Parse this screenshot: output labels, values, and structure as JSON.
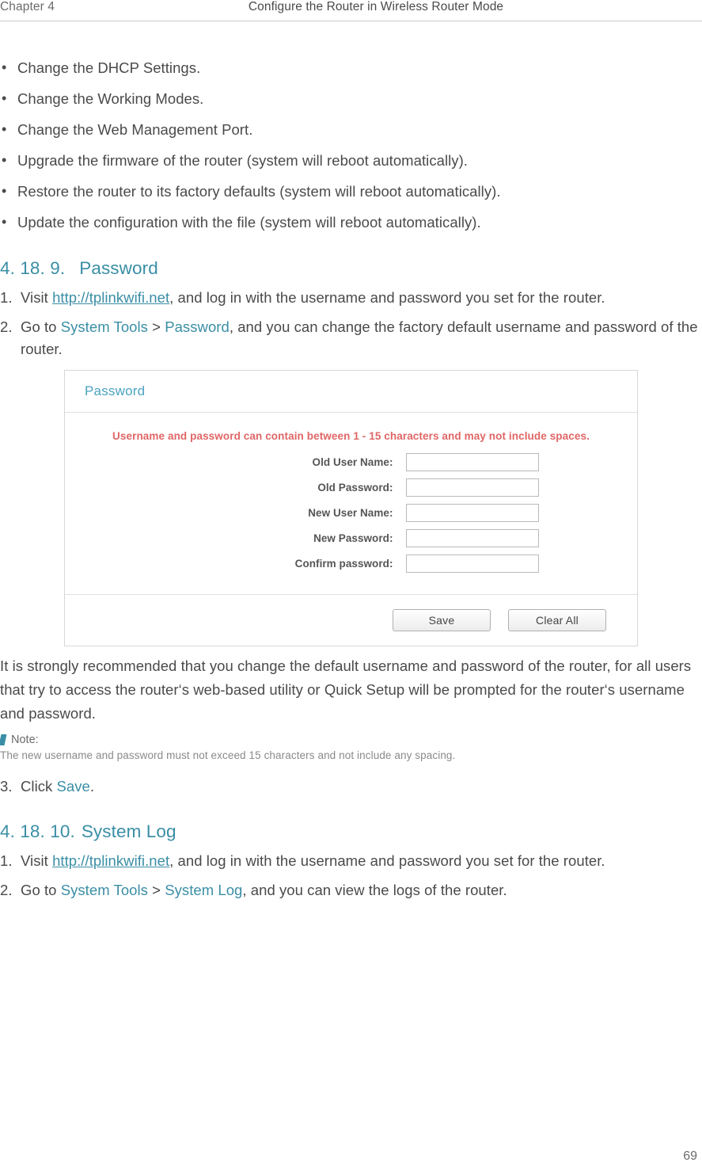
{
  "header": {
    "chapter": "Chapter 4",
    "title": "Configure the Router in Wireless Router Mode"
  },
  "bullets": [
    "Change the DHCP Settings.",
    "Change the Working Modes.",
    "Change the Web Management Port.",
    "Upgrade the firmware of the router (system will reboot automatically).",
    "Restore the router to its factory defaults (system will reboot automatically).",
    "Update the configuration with the file (system will reboot automatically)."
  ],
  "section_password": {
    "number": "4. 18. 9.",
    "title": "Password",
    "step1": {
      "marker": "1.",
      "pre": "Visit ",
      "link": "http://tplinkwifi.net",
      "post": ", and log in with the username and password you set for the router."
    },
    "step2": {
      "marker": "2.",
      "pre": "Go to ",
      "menu1": "System Tools",
      "sep": " > ",
      "menu2": "Password",
      "post": ", and you can change the factory default username and password of the router."
    },
    "paragraph": "It is strongly recommended that you change the default username and password of the router, for all users that try to access the router‘s web-based utility or Quick Setup will be prompted for the router‘s username and password.",
    "note_label": "Note:",
    "note_text": "The new username and password must not exceed 15 characters and not include any spacing.",
    "step3": {
      "marker": "3.",
      "pre": "Click ",
      "action": "Save",
      "post": "."
    }
  },
  "screenshot": {
    "panel_title": "Password",
    "hint": "Username and password can contain between 1 - 15 characters and may not include spaces.",
    "fields": [
      {
        "label": "Old User Name:",
        "value": ""
      },
      {
        "label": "Old Password:",
        "value": ""
      },
      {
        "label": "New User Name:",
        "value": ""
      },
      {
        "label": "New Password:",
        "value": ""
      },
      {
        "label": "Confirm password:",
        "value": ""
      }
    ],
    "buttons": [
      {
        "label": "Save"
      },
      {
        "label": "Clear All"
      }
    ]
  },
  "section_syslog": {
    "number": "4. 18. 10.",
    "title": "System Log",
    "step1": {
      "marker": "1.",
      "pre": "Visit ",
      "link": "http://tplinkwifi.net",
      "post": ", and log in with the username and password you set for the router."
    },
    "step2": {
      "marker": "2.",
      "pre": "Go to ",
      "menu1": "System Tools",
      "sep": " > ",
      "menu2": "System Log",
      "post": ", and you can view the logs of the router."
    }
  },
  "footer": {
    "page_number": "69"
  },
  "colors": {
    "accent": "#3a8ea5",
    "panel_title": "#4aa3c0",
    "hint": "#e06666"
  }
}
